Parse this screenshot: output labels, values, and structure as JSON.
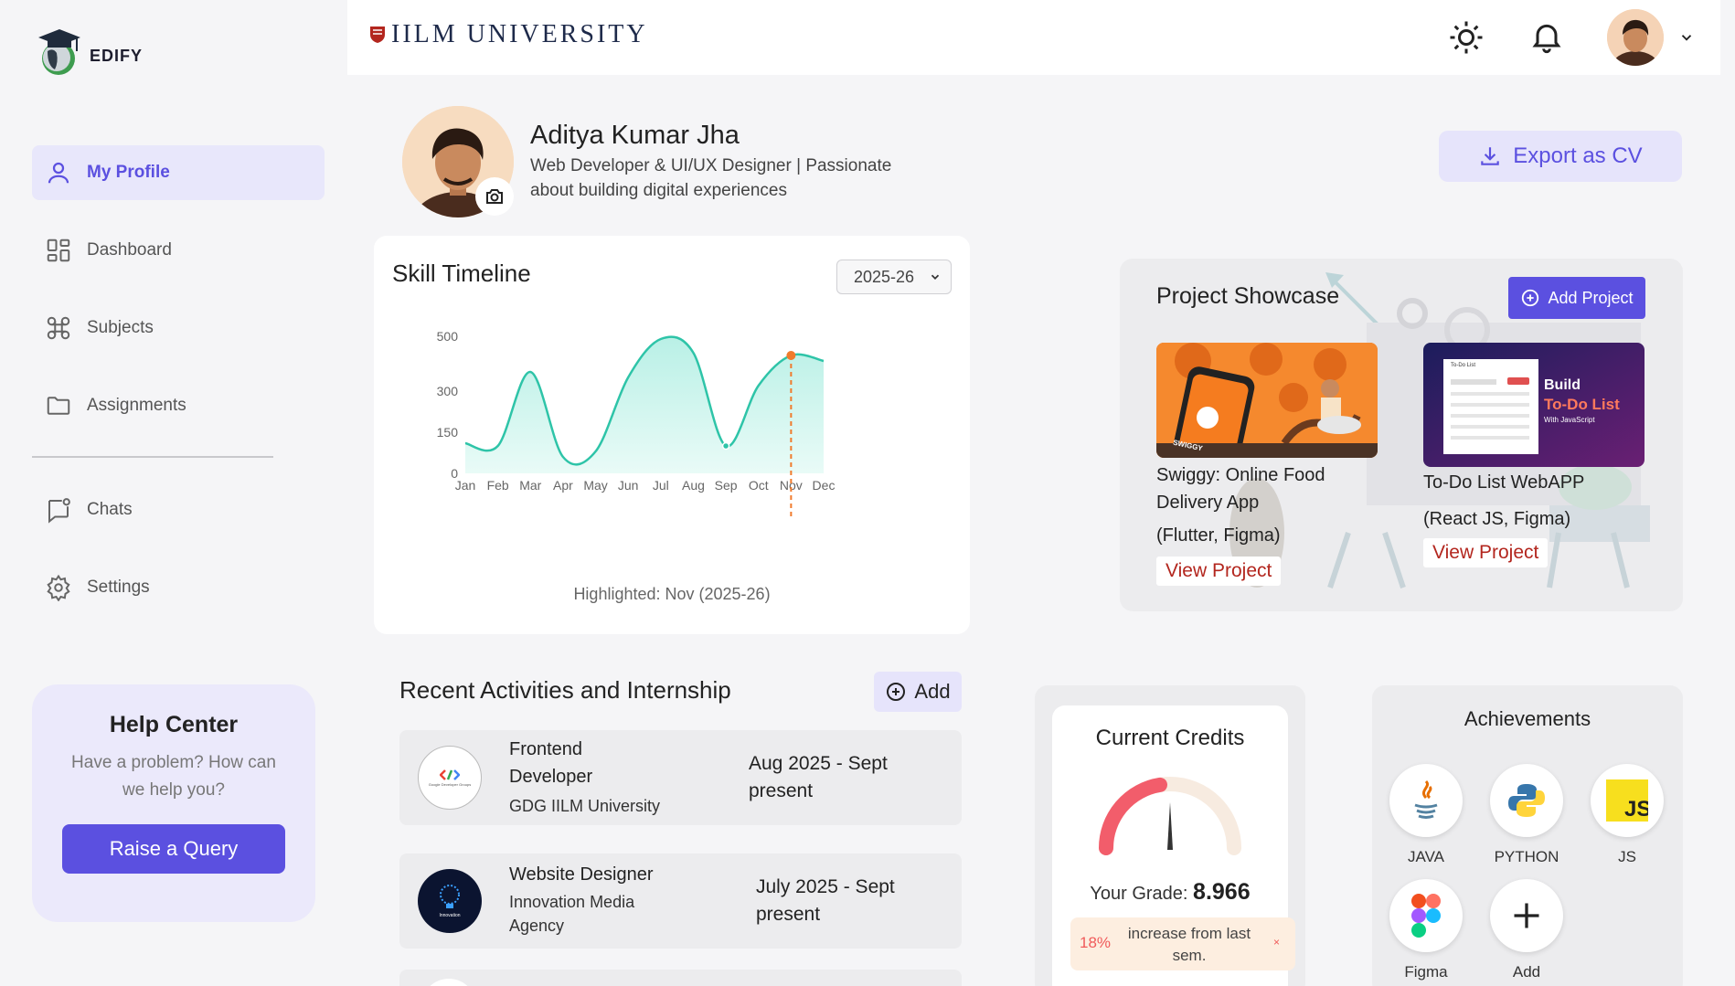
{
  "brand": {
    "name": "EDIFY",
    "university": "IILM UNIVERSITY"
  },
  "sidebar": {
    "items": [
      {
        "label": "My Profile",
        "icon": "user-icon",
        "active": true
      },
      {
        "label": "Dashboard",
        "icon": "grid-icon"
      },
      {
        "label": "Subjects",
        "icon": "command-icon"
      },
      {
        "label": "Assignments",
        "icon": "folder-icon"
      },
      {
        "label": "Chats",
        "icon": "chat-icon"
      },
      {
        "label": "Settings",
        "icon": "gear-icon"
      }
    ],
    "help": {
      "title": "Help Center",
      "text": "Have a problem? How can we help you?",
      "button": "Raise a Query"
    }
  },
  "profile": {
    "name": "Aditya Kumar Jha",
    "description": "Web Developer & UI/UX Designer | Passionate about building digital experiences",
    "export_label": "Export as CV"
  },
  "skill_timeline": {
    "title": "Skill Timeline",
    "year_selected": "2025-26",
    "highlight_text": "Highlighted: Nov (2025-26)"
  },
  "chart_data": {
    "type": "area",
    "categories": [
      "Jan",
      "Feb",
      "Mar",
      "Apr",
      "May",
      "Jun",
      "Jul",
      "Aug",
      "Sep",
      "Oct",
      "Nov",
      "Dec"
    ],
    "values": [
      110,
      100,
      370,
      60,
      80,
      350,
      490,
      440,
      100,
      320,
      430,
      410
    ],
    "yticks": [
      0,
      150,
      300,
      500
    ],
    "ylim": [
      0,
      500
    ],
    "highlight_index": 10,
    "fill_color": "#b9f0e6",
    "line_color": "#2ec4a8",
    "highlight_color": "#f07b2c"
  },
  "projects": {
    "title": "Project Showcase",
    "add_label": "Add Project",
    "items": [
      {
        "title": "Swiggy: Online Food Delivery App",
        "tech": "(Flutter, Figma)",
        "view_label": "View Project",
        "thumb_label": "SWIGGY"
      },
      {
        "title": "To-Do List WebAPP",
        "tech": "(React JS, Figma)",
        "view_label": "View Project",
        "thumb_title": "Build",
        "thumb_highlight": "To-Do List",
        "thumb_sub": "With JavaScript",
        "thumb_doc_title": "To-Do List"
      }
    ]
  },
  "activities": {
    "title": "Recent Activities and Internship",
    "add_label": "Add",
    "items": [
      {
        "title": "Frontend Developer",
        "org": "GDG IILM University",
        "date": "Aug 2025 - Sept present",
        "logo_text": "Google Developer Groups"
      },
      {
        "title": "Website Designer",
        "org": "Innovation Media Agency",
        "date": "July 2025 - Sept present",
        "logo_text": "Innovation"
      }
    ]
  },
  "credits": {
    "title": "Current Credits",
    "grade_label": "Your Grade:",
    "grade_value": "8.966",
    "increase_pct": "18%",
    "increase_text": "increase from last sem.",
    "gauge_fraction": 0.45
  },
  "achievements": {
    "title": "Achievements",
    "items": [
      {
        "label": "JAVA",
        "icon": "java-icon"
      },
      {
        "label": "PYTHON",
        "icon": "python-icon"
      },
      {
        "label": "JS",
        "icon": "js-icon"
      },
      {
        "label": "Figma",
        "icon": "figma-icon"
      },
      {
        "label": "Add",
        "icon": "plus-icon"
      }
    ]
  },
  "colors": {
    "accent": "#5b50e0",
    "accent_light": "#e8e7fb",
    "danger": "#b3261e"
  }
}
